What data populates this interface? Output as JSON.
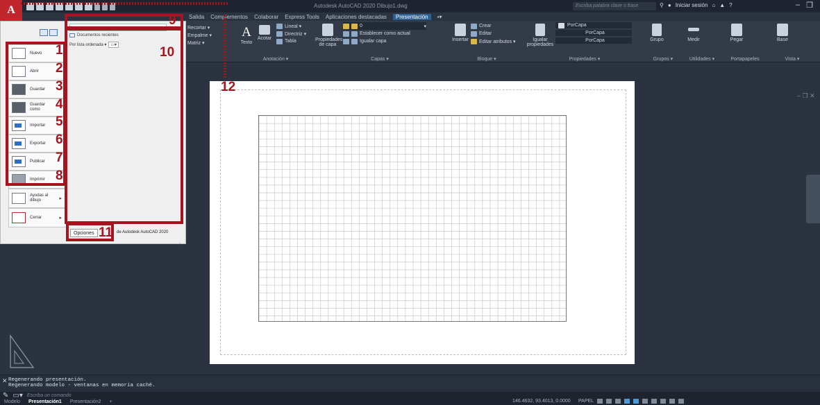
{
  "titlebar": {
    "window_title": "Autodesk AutoCAD 2020   Dibujo1.dwg",
    "search_placeholder": "Escriba palabra clave o frase",
    "signin": "Iniciar sesión",
    "app_letter": "A"
  },
  "ribbon_tabs": [
    "Salida",
    "Complementos",
    "Colaborar",
    "Express Tools",
    "Aplicaciones destacadas",
    "Presentación"
  ],
  "ribbon": {
    "modify": [
      "Recortar ▾",
      "Empalme ▾",
      "Matriz ▾"
    ],
    "annotation": {
      "texto": "Texto",
      "acotar": "Acotar",
      "lineal": "Lineal ▾",
      "directriz": "Directriz ▾",
      "tabla": "Tabla",
      "title": "Anotación ▾"
    },
    "layers": {
      "propiedades": "Propiedades",
      "de_capa": "de capa",
      "layer_name": "0",
      "establecer": "Establecer como actual",
      "igualar": "Igualar capa",
      "title": "Capas ▾"
    },
    "block": {
      "insertar": "Insertar",
      "crear": "Crear",
      "editar": "Editar",
      "editar_atributos": "Editar atributos ▾",
      "title": "Bloque ▾"
    },
    "properties": {
      "igualar": "Igualar",
      "propiedades": "propiedades",
      "combo1": "PorCapa",
      "combo2": "PorCapa",
      "combo3": "PorCapa",
      "title": "Propiedades ▾"
    },
    "groups": {
      "grupo": "Grupo",
      "title": "Grupos ▾"
    },
    "utilities": {
      "medir": "Medir",
      "title": "Utilidades ▾"
    },
    "clipboard": {
      "pegar": "Pegar",
      "title": "Portapapeles"
    },
    "view": {
      "base": "Base",
      "title": "Vista ▾"
    }
  },
  "app_menu": {
    "items": [
      {
        "label": "Nuevo",
        "num": "1"
      },
      {
        "label": "Abrir",
        "num": "2"
      },
      {
        "label": "Guardar",
        "num": "3"
      },
      {
        "label": "Guardar como",
        "num": "4"
      },
      {
        "label": "Importar",
        "num": "5"
      },
      {
        "label": "Exportar",
        "num": "6"
      },
      {
        "label": "Publicar",
        "num": "7"
      },
      {
        "label": "Imprimir",
        "num": "8"
      },
      {
        "label": "Ayudas al dibujo",
        "num": ""
      },
      {
        "label": "Cerrar",
        "num": ""
      }
    ],
    "recent_header": "Documentos recientes",
    "sort_label": "Por lista ordenada ▾",
    "options_button": "Opciones",
    "exit_label": "de Autodesk AutoCAD 2020"
  },
  "annotations": {
    "n9": "9",
    "n10": "10",
    "n11": "11",
    "n12": "12"
  },
  "command_line": {
    "history": [
      "Regenerando presentación.",
      "Regenerando modelo - ventanas en memoria caché."
    ],
    "input_placeholder": "Escriba un comando"
  },
  "status_bar": {
    "tabs": [
      "Modelo",
      "Presentación1",
      "Presentación2",
      "+"
    ],
    "coords": "146.4632, 93.4013, 0.0000",
    "space": "PAPEL"
  },
  "colors": {
    "annotation": "#a7141f",
    "app_button": "#c0272d",
    "active_tab": "#2f5f8f"
  }
}
